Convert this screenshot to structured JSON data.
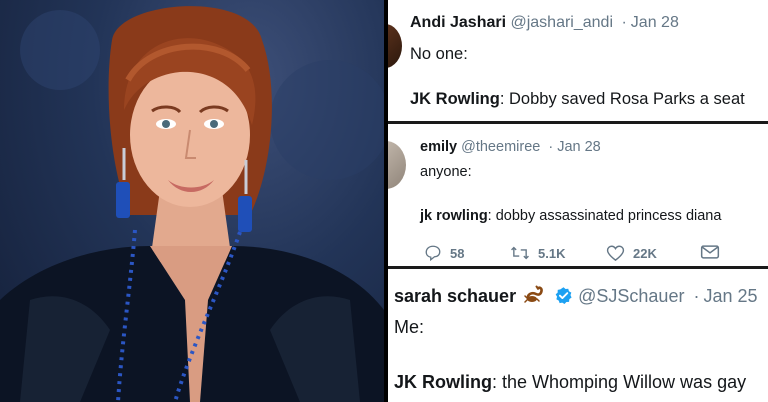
{
  "tweets": [
    {
      "name": "Andi Jashari",
      "handle": "@jashari_andi",
      "date": "Jan 28",
      "line1": "No one:",
      "line2_bold": "JK Rowling",
      "line2_rest": ": Dobby saved Rosa Parks a seat"
    },
    {
      "name": "emily",
      "handle": "@theemiree",
      "date": "Jan 28",
      "line1": "anyone:",
      "line2_bold": "jk rowling",
      "line2_rest": ": dobby assassinated princess diana",
      "replies": "58",
      "retweets": "5.1K",
      "likes": "22K"
    },
    {
      "name": "sarah schauer",
      "handle": "@SJSchauer",
      "date": "Jan 25",
      "line1": "Me:",
      "line2_bold": "JK Rowling",
      "line2_rest": ": the Whomping Willow was gay"
    }
  ],
  "dot": "·",
  "icons": {
    "reply": "reply-icon",
    "retweet": "retweet-icon",
    "like": "heart-icon",
    "dm": "mail-icon",
    "emoji": "scorpion-emoji-icon",
    "verified": "verified-badge-icon"
  },
  "colors": {
    "text": "#14171a",
    "muted": "#657786",
    "verified": "#1da1f2",
    "divider": "#000000"
  }
}
